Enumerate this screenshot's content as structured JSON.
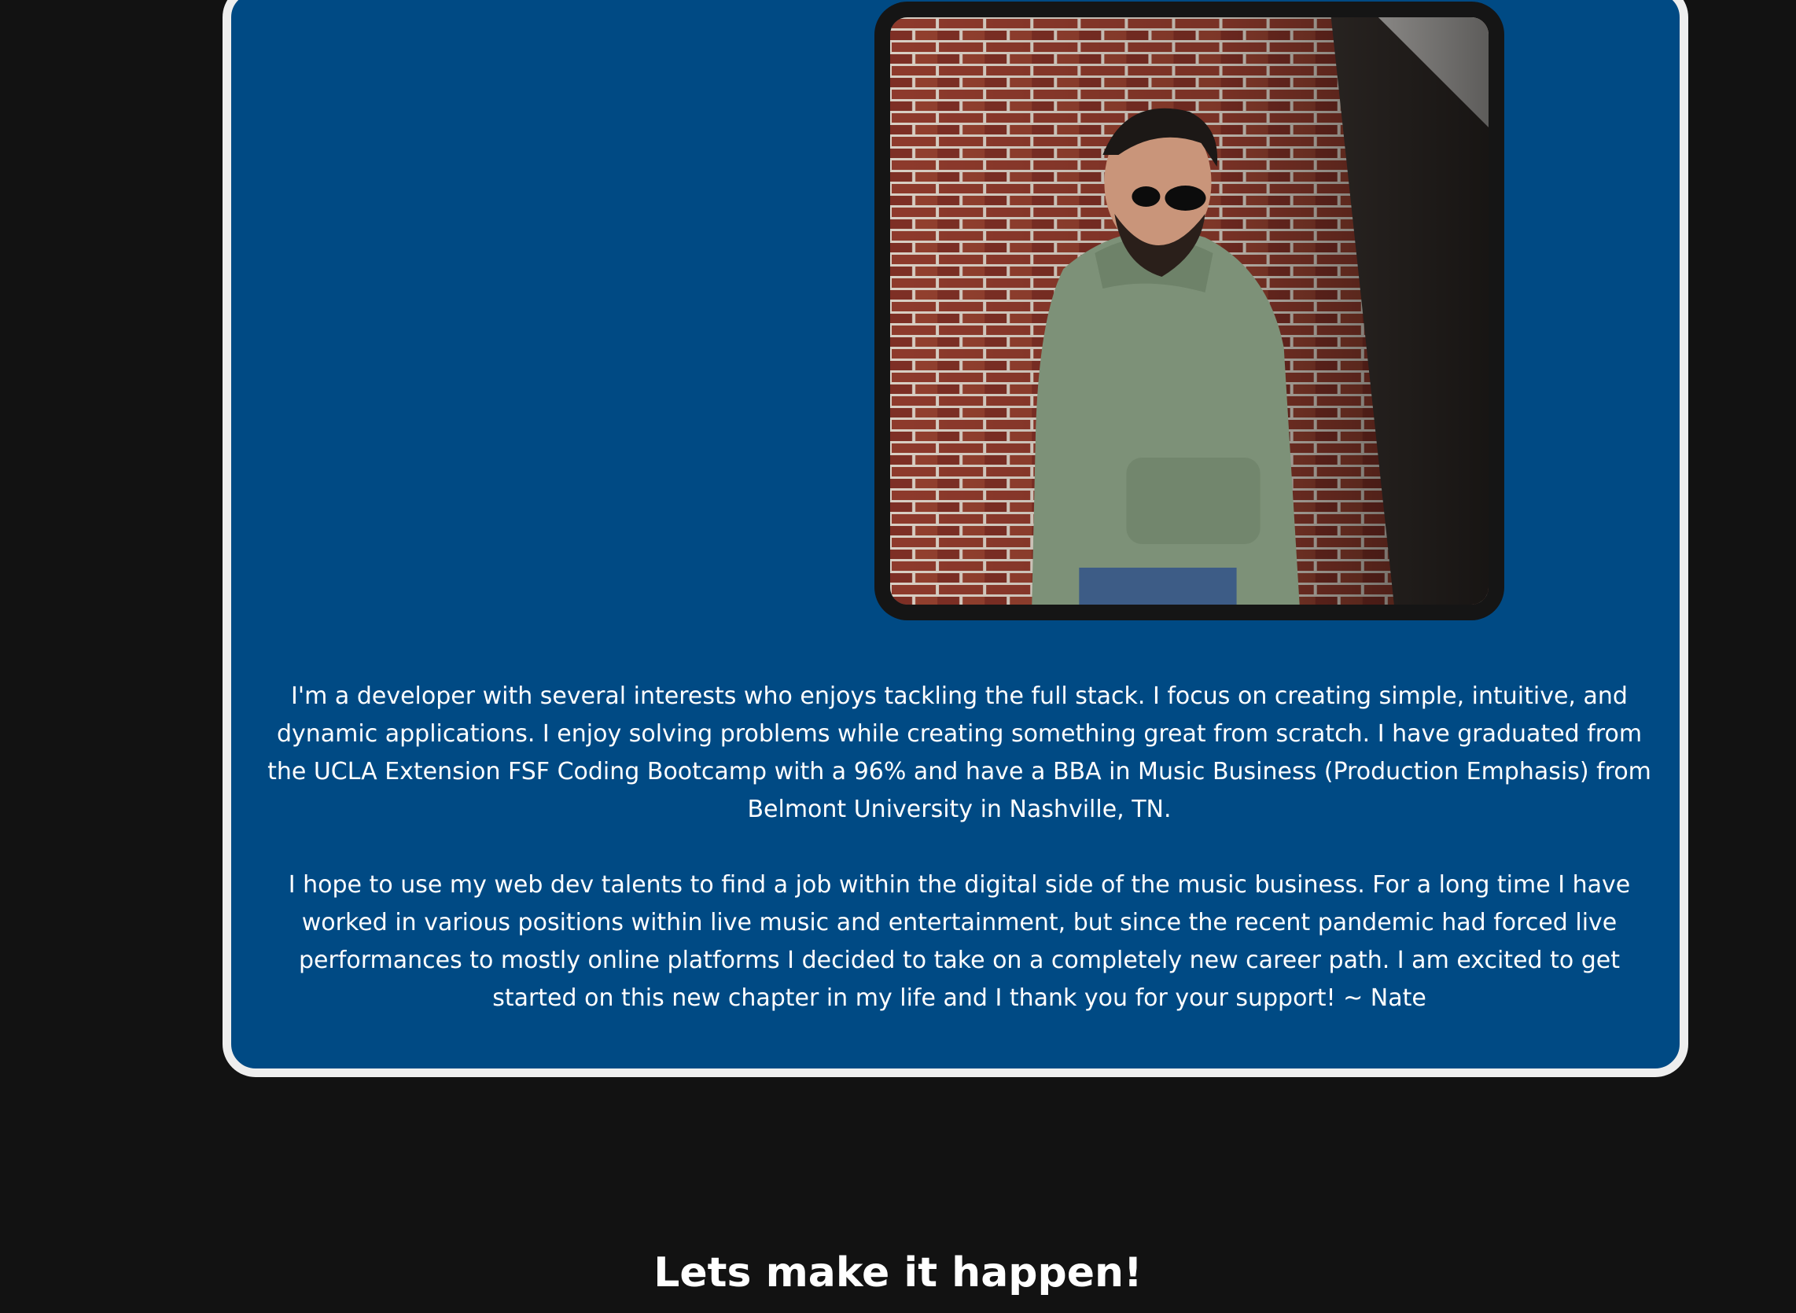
{
  "about": {
    "photo_alt": "Nate leaning against a brick wall",
    "paragraph_1": "I'm a developer with several interests who enjoys tackling the full stack. I focus on creating simple, intuitive, and dynamic applications. I enjoy solving problems while creating something great from scratch. I have graduated from the UCLA Extension FSF Coding Bootcamp with a 96% and have a BBA in Music Business (Production Emphasis) from Belmont University in Nashville, TN.",
    "paragraph_2": "I hope to use my web dev talents to find a job within the digital side of the music business. For a long time I have worked in various positions within live music and entertainment, but since the recent pandemic had forced live performances to mostly online platforms I decided to take on a completely new career path. I am excited to get started on this new chapter in my life and I thank you for your support! ~ Nate"
  },
  "contact": {
    "heading": "Lets make it happen!"
  },
  "colors": {
    "page_background": "#121212",
    "card_background": "#004a84",
    "card_border": "#eeeeee",
    "text": "#ffffff"
  }
}
